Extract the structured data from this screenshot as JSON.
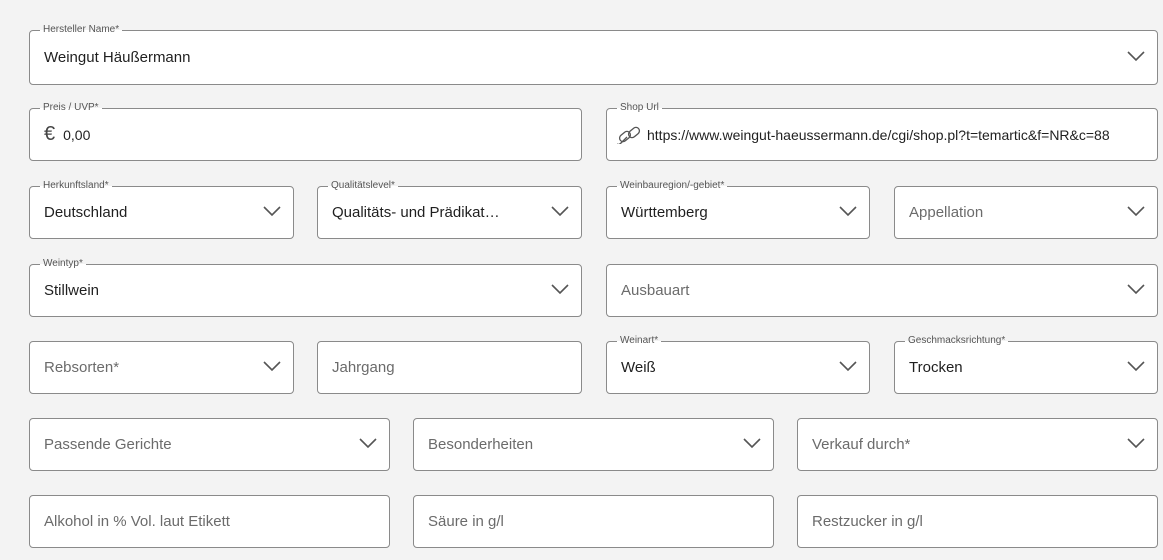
{
  "fields": {
    "hersteller": {
      "label": "Hersteller Name*",
      "value": "Weingut Häußermann"
    },
    "preis": {
      "label": "Preis / UVP*",
      "currency": "€",
      "value": "0,00"
    },
    "shop": {
      "label": "Shop Url",
      "value": "https://www.weingut-haeussermann.de/cgi/shop.pl?t=temartic&f=NR&c=88"
    },
    "herkunftsland": {
      "label": "Herkunftsland*",
      "value": "Deutschland"
    },
    "qualitaetslevel": {
      "label": "Qualitätslevel*",
      "value": "Qualitäts- und Prädikat…"
    },
    "weinbauregion": {
      "label": "Weinbauregion/-gebiet*",
      "value": "Württemberg"
    },
    "appellation": {
      "placeholder": "Appellation"
    },
    "weintyp": {
      "label": "Weintyp*",
      "value": "Stillwein"
    },
    "ausbauart": {
      "placeholder": "Ausbauart"
    },
    "rebsorten": {
      "placeholder": "Rebsorten*"
    },
    "jahrgang": {
      "placeholder": "Jahrgang"
    },
    "weinart": {
      "label": "Weinart*",
      "value": "Weiß"
    },
    "geschmack": {
      "label": "Geschmacksrichtung*",
      "value": "Trocken"
    },
    "gerichte": {
      "placeholder": "Passende Gerichte"
    },
    "besonderheiten": {
      "placeholder": "Besonderheiten"
    },
    "verkauf": {
      "placeholder": "Verkauf durch*"
    },
    "alkohol": {
      "placeholder": "Alkohol in % Vol. laut Etikett"
    },
    "saeure": {
      "placeholder": "Säure in g/l"
    },
    "restzucker": {
      "placeholder": "Restzucker in g/l"
    }
  }
}
